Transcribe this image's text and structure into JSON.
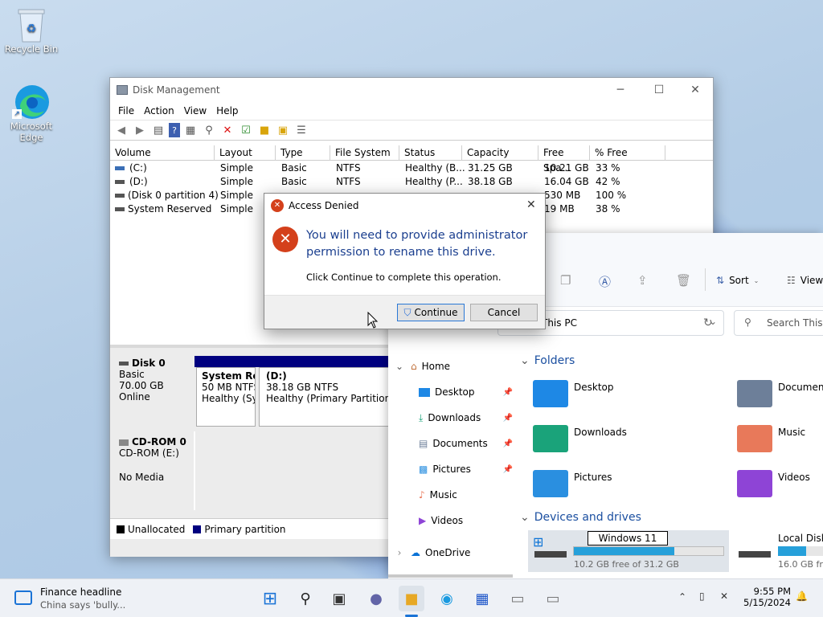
{
  "desktop": {
    "icons": [
      {
        "label": "Recycle Bin"
      },
      {
        "label": "Microsoft Edge"
      }
    ]
  },
  "disk_management": {
    "title": "Disk Management",
    "menu": [
      "File",
      "Action",
      "View",
      "Help"
    ],
    "columns": [
      "Volume",
      "Layout",
      "Type",
      "File System",
      "Status",
      "Capacity",
      "Free Spa...",
      "% Free"
    ],
    "rows": [
      {
        "volume": "(C:)",
        "layout": "Simple",
        "type": "Basic",
        "fs": "NTFS",
        "status": "Healthy (B...",
        "capacity": "31.25 GB",
        "free": "10.21 GB",
        "pct": "33 %"
      },
      {
        "volume": "(D:)",
        "layout": "Simple",
        "type": "Basic",
        "fs": "NTFS",
        "status": "Healthy (P...",
        "capacity": "38.18 GB",
        "free": "16.04 GB",
        "pct": "42 %"
      },
      {
        "volume": "(Disk 0 partition 4)",
        "layout": "Simple",
        "type": "Basic",
        "fs": "",
        "status": "Healthy (R...",
        "capacity": "530 MB",
        "free": "530 MB",
        "pct": "100 %"
      },
      {
        "volume": "System Reserved",
        "layout": "Simple",
        "type": "",
        "fs": "",
        "status": "",
        "capacity": "",
        "free": "19 MB",
        "pct": "38 %"
      }
    ],
    "disk0": {
      "name": "Disk 0",
      "type": "Basic",
      "size": "70.00 GB",
      "state": "Online"
    },
    "partitions": [
      {
        "name": "System Res",
        "size": "50 MB NTFS",
        "status": "Healthy (Sys"
      },
      {
        "name": "(D:)",
        "size": "38.18 GB NTFS",
        "status": "Healthy (Primary Partition)"
      }
    ],
    "cdrom": {
      "name": "CD-ROM 0",
      "type": "CD-ROM (E:)",
      "state": "No Media"
    },
    "legend": [
      {
        "label": "Unallocated",
        "color": "#000000"
      },
      {
        "label": "Primary partition",
        "color": "#00007f"
      }
    ]
  },
  "dialog": {
    "title": "Access Denied",
    "message": "You will need to provide administrator permission to rename this drive.",
    "sub": "Click Continue to complete this operation.",
    "continue_label": "Continue",
    "cancel_label": "Cancel"
  },
  "explorer": {
    "sort_label": "Sort",
    "view_label": "View",
    "address": "This PC",
    "search_placeholder": "Search This P",
    "nav": [
      {
        "label": "Home"
      },
      {
        "label": "Desktop"
      },
      {
        "label": "Downloads"
      },
      {
        "label": "Documents"
      },
      {
        "label": "Pictures"
      },
      {
        "label": "Music"
      },
      {
        "label": "Videos"
      },
      {
        "label": "OneDrive"
      }
    ],
    "folders_header": "Folders",
    "folders": [
      {
        "label": "Desktop",
        "color": "#1e88e5"
      },
      {
        "label": "Documents",
        "color": "#6d7f99"
      },
      {
        "label": "Downloads",
        "color": "#1aa37a"
      },
      {
        "label": "Music",
        "color": "#e8795a"
      },
      {
        "label": "Pictures",
        "color": "#2a8fe0"
      },
      {
        "label": "Videos",
        "color": "#8e44d6"
      }
    ],
    "drives_header": "Devices and drives",
    "drives": [
      {
        "label": "Windows 11",
        "free": "10.2 GB free of 31.2 GB",
        "used_fraction": 0.67
      },
      {
        "label": "Local Disk",
        "free": "16.0 GB fre",
        "used_fraction": 0.58
      }
    ]
  },
  "taskbar": {
    "news_title": "Finance headline",
    "news_sub": "China says 'bully...",
    "time": "9:55 PM",
    "date": "5/15/2024"
  }
}
